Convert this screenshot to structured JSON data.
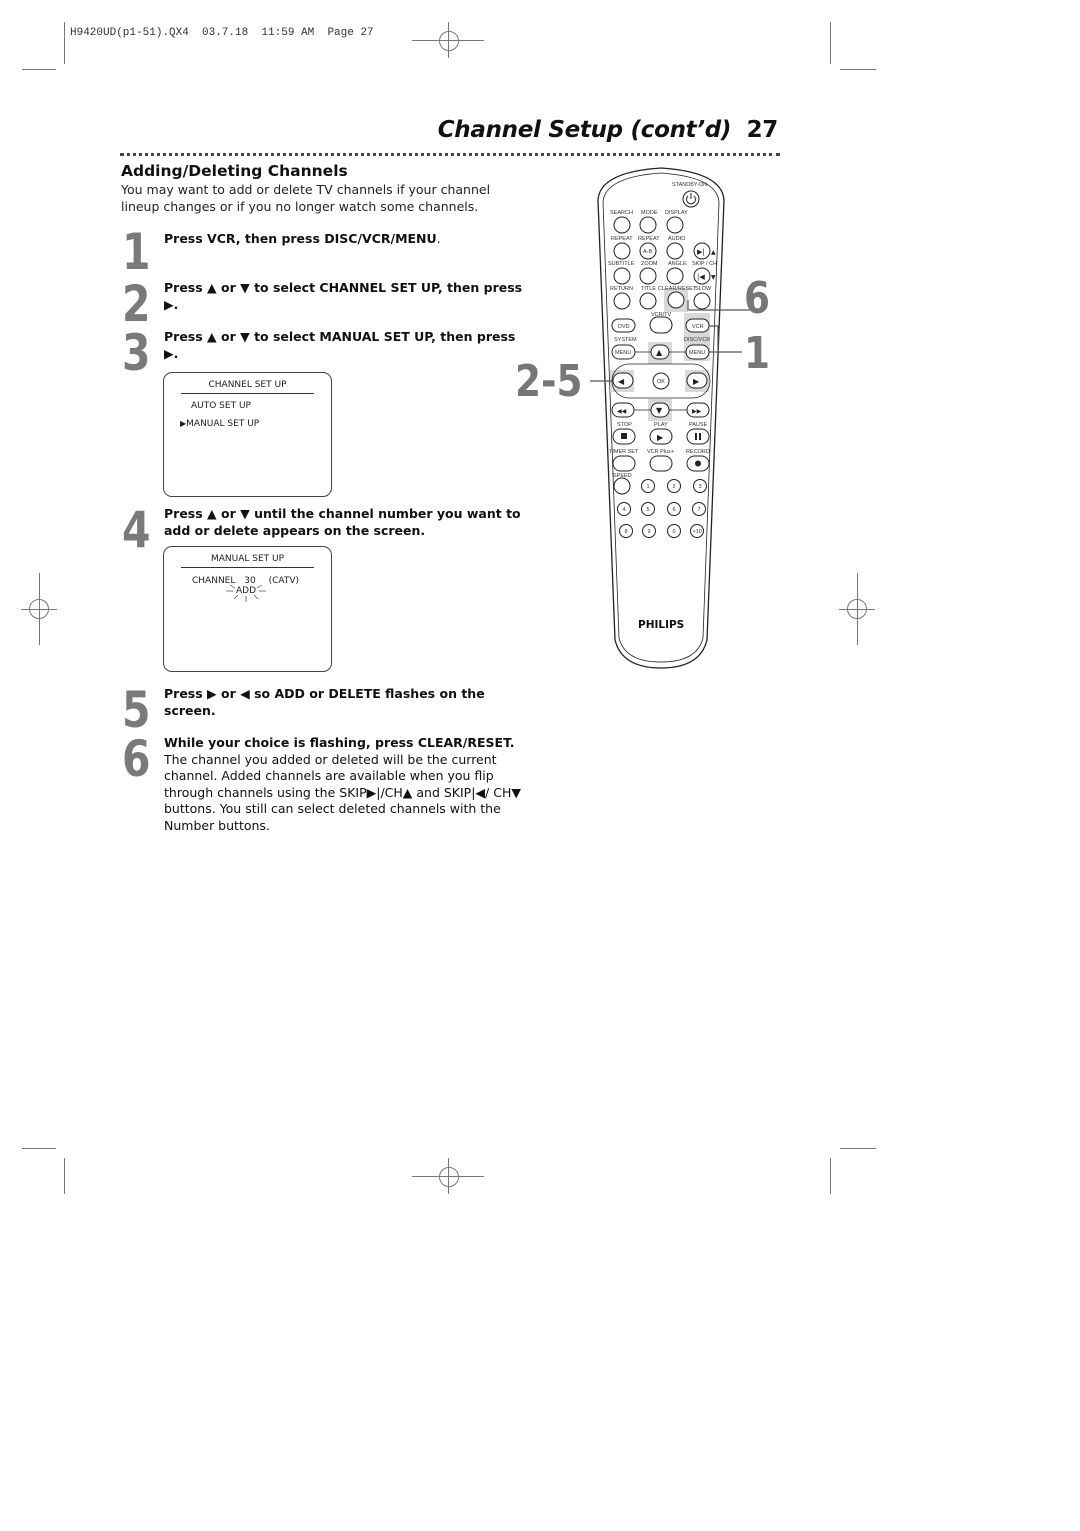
{
  "slug": "H9420UD(p1-51).QX4  03.7.18  11:59 AM  Page 27",
  "header": {
    "title": "Channel Setup (cont’d)",
    "page_number": "27"
  },
  "section": {
    "heading": "Adding/Deleting Channels",
    "intro": "You may want to add or delete TV channels if your channel lineup changes or if you no longer watch some channels."
  },
  "steps": [
    {
      "num": "1",
      "parts": [
        "Press VCR, then press DISC/VCR/MENU",
        "."
      ]
    },
    {
      "num": "2",
      "text": "Press ▲ or ▼ to select CHANNEL SET UP, then press ▶."
    },
    {
      "num": "3",
      "text": "Press ▲ or ▼ to select MANUAL SET UP, then press ▶."
    },
    {
      "num": "4",
      "text": "Press ▲ or ▼ until the channel number you want to add or delete appears on the screen."
    },
    {
      "num": "5",
      "text": "Press ▶ or ◀ so ADD or DELETE flashes on the screen."
    },
    {
      "num": "6",
      "bold": "While your choice is flashing, press CLEAR/RESET.",
      "text": " The channel you added or deleted will be the current channel. Added channels are available when you flip through channels using the SKIP▶|/CH▲ and SKIP|◀/ CH▼ buttons. You still can select deleted channels with the Number buttons."
    }
  ],
  "screen1": {
    "title": "CHANNEL SET UP",
    "items": [
      "AUTO SET UP",
      "MANUAL SET UP"
    ],
    "selected_marker": "▶",
    "selected_index": 1
  },
  "screen2": {
    "title": "MANUAL SET UP",
    "channel_label": "CHANNEL",
    "channel_number": "30",
    "channel_type": "(CATV)",
    "status": "ADD"
  },
  "remote": {
    "brand": "PHILIPS",
    "callouts": {
      "c6": "6",
      "c1": "1",
      "c25": "2-5"
    },
    "labels": {
      "standby": "STANDBY-ON",
      "search": "SEARCH",
      "mode": "MODE",
      "display": "DISPLAY",
      "repeat1": "REPEAT",
      "repeat2": "REPEAT",
      "audio": "AUDIO",
      "ab": "A-B",
      "subtitle": "SUBTITLE",
      "zoom": "ZOOM",
      "angle": "ANGLE",
      "skipch": "SKIP / CH",
      "return": "RETURN",
      "title": "TITLE",
      "clearreset": "CLEAR/RESET",
      "slow": "SLOW",
      "vcrtv": "VCR/TV",
      "dvd": "DVD",
      "vcr": "VCR",
      "system": "SYSTEM",
      "discvcr": "DISC/VCR",
      "menu1": "MENU",
      "menu2": "MENU",
      "ok": "OK",
      "stop": "STOP",
      "play": "PLAY",
      "pause": "PAUSE",
      "timerset": "TIMER SET",
      "vcrplus": "VCR Plus+",
      "record": "RECORD",
      "speed": "SPEED",
      "n1": "1",
      "n2": "2",
      "n3": "3",
      "n4": "4",
      "n5": "5",
      "n6": "6",
      "n7": "7",
      "n8": "8",
      "n9": "9",
      "n0": "0",
      "n10": "+10"
    }
  }
}
